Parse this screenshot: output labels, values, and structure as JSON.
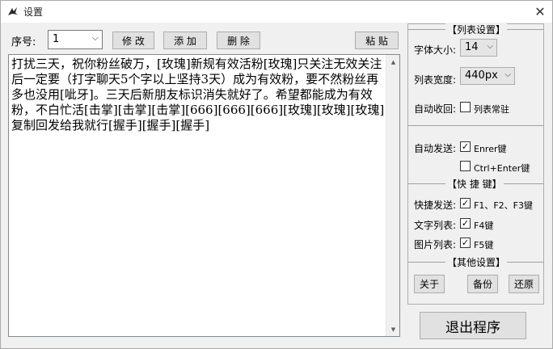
{
  "window": {
    "title": "设置",
    "close_label": "✕"
  },
  "toolbar": {
    "seq_label": "序号:",
    "seq_value": "1",
    "modify_label": "修 改",
    "add_label": "添 加",
    "delete_label": "删 除",
    "paste_label": "粘 贴"
  },
  "editor": {
    "content": "打扰三天，祝你粉丝破万，[玫瑰]新规有效活粉[玫瑰]只关注无效关注后一定要（打字聊天5个字以上坚持3天）成为有效粉，要不然粉丝再多也没用[呲牙]。三天后新朋友标识消失就好了。希望都能成为有效粉，不白忙活[击掌][击掌][击掌][666][666][666][玫瑰][玫瑰][玫瑰]\n复制回发给我就行[握手][握手][握手]"
  },
  "panel": {
    "list_settings": {
      "header": "【列表设置】",
      "font_size_label": "字体大小:",
      "font_size_value": "14",
      "list_width_label": "列表宽度:",
      "list_width_value": "440px",
      "auto_collapse_label": "自动收回:",
      "always_on_label": "列表常驻",
      "always_on_checked": false
    },
    "auto_send": {
      "label": "自动发送:",
      "enter_label": "Enrer键",
      "enter_checked": true,
      "ctrl_enter_label": "Ctrl+Enter键",
      "ctrl_enter_checked": false
    },
    "shortcuts": {
      "header": "【快 捷 键】",
      "quick_send_label": "快捷发送:",
      "quick_send_keys": "F1、F2、F3键",
      "quick_send_checked": true,
      "text_list_label": "文字列表:",
      "text_list_key": "F4键",
      "text_list_checked": true,
      "image_list_label": "图片列表:",
      "image_list_key": "F5键",
      "image_list_checked": true
    },
    "other": {
      "header": "【其他设置】",
      "about_label": "关于",
      "backup_label": "备份",
      "restore_label": "还原"
    }
  },
  "exit_label": "退出程序"
}
